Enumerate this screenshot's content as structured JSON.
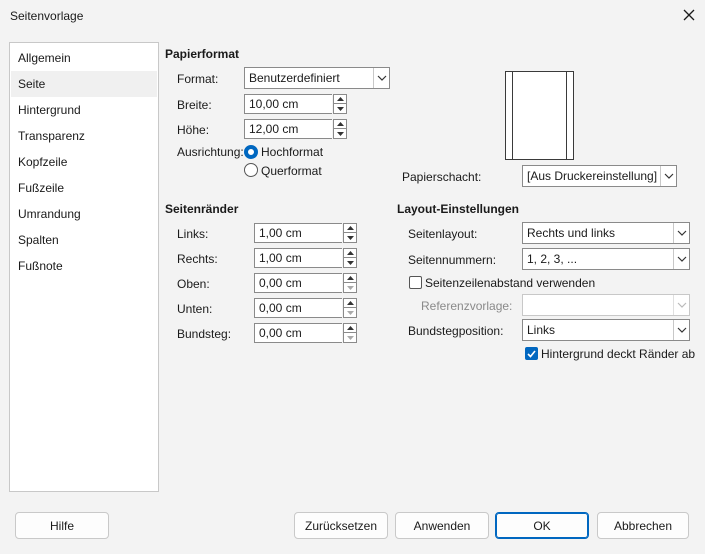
{
  "window": {
    "title": "Seitenvorlage"
  },
  "sidebar": {
    "items": [
      {
        "label": "Allgemein"
      },
      {
        "label": "Seite"
      },
      {
        "label": "Hintergrund"
      },
      {
        "label": "Transparenz"
      },
      {
        "label": "Kopfzeile"
      },
      {
        "label": "Fußzeile"
      },
      {
        "label": "Umrandung"
      },
      {
        "label": "Spalten"
      },
      {
        "label": "Fußnote"
      }
    ],
    "selected": "Seite"
  },
  "papierformat": {
    "heading": "Papierformat",
    "format_label": "Format:",
    "format_value": "Benutzerdefiniert",
    "breite_label": "Breite:",
    "breite_value": "10,00 cm",
    "hoehe_label": "Höhe:",
    "hoehe_value": "12,00 cm",
    "ausrichtung_label": "Ausrichtung:",
    "hochformat_label": "Hochformat",
    "querformat_label": "Querformat",
    "selected_orientation": "Hochformat",
    "papierschacht_label": "Papierschacht:",
    "papierschacht_value": "[Aus Druckereinstellung]"
  },
  "seitenraender": {
    "heading": "Seitenränder",
    "links_label": "Links:",
    "links_value": "1,00 cm",
    "rechts_label": "Rechts:",
    "rechts_value": "1,00 cm",
    "oben_label": "Oben:",
    "oben_value": "0,00 cm",
    "unten_label": "Unten:",
    "unten_value": "0,00 cm",
    "bundsteg_label": "Bundsteg:",
    "bundsteg_value": "0,00 cm"
  },
  "layout": {
    "heading": "Layout-Einstellungen",
    "seitenlayout_label": "Seitenlayout:",
    "seitenlayout_value": "Rechts und links",
    "seitennummern_label": "Seitennummern:",
    "seitennummern_value": "1, 2, 3, ...",
    "zeilenabstand_label": "Seitenzeilenabstand verwenden",
    "zeilenabstand_checked": false,
    "referenz_label": "Referenzvorlage:",
    "referenz_value": "",
    "bundstegposition_label": "Bundstegposition:",
    "bundstegposition_value": "Links",
    "hintergrund_label": "Hintergrund deckt Ränder ab",
    "hintergrund_checked": true
  },
  "buttons": {
    "hilfe": "Hilfe",
    "zuruecksetzen": "Zurücksetzen",
    "anwenden": "Anwenden",
    "ok": "OK",
    "abbrechen": "Abbrechen"
  },
  "colors": {
    "accent": "#0067c0",
    "background": "#f3f3f3"
  },
  "icons": [
    "close-icon",
    "chevron-down-icon",
    "spin-up-icon",
    "spin-down-icon",
    "checkmark-icon"
  ]
}
